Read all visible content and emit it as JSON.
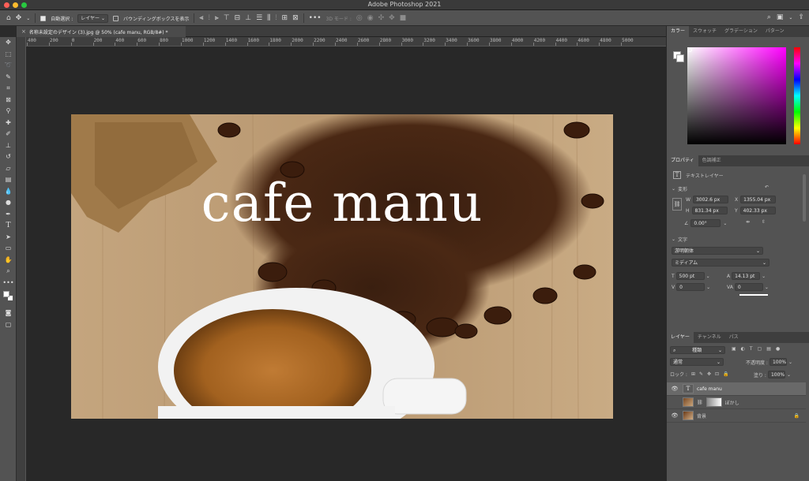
{
  "window": {
    "title": "Adobe Photoshop 2021"
  },
  "options_bar": {
    "auto_select_label": "自動選択 :",
    "auto_select_value": "レイヤー",
    "bounding_box_label": "バウンディングボックスを表示",
    "mode_3d_label": "3D モード :"
  },
  "document": {
    "tab_title": "名称未設定のデザイン (3).jpg @ 50% (cafe manu, RGB/8#) *",
    "canvas_text": "cafe manu",
    "ruler_labels": [
      "400",
      "200",
      "0",
      "200",
      "400",
      "600",
      "800",
      "1000",
      "1200",
      "1400",
      "1600",
      "1800",
      "2000",
      "2200",
      "2400",
      "2600",
      "2800",
      "3000",
      "3200",
      "3400",
      "3600",
      "3800",
      "4000",
      "4200",
      "4400",
      "4600",
      "4800",
      "5000"
    ]
  },
  "color_panel": {
    "tabs": [
      "カラー",
      "スウォッチ",
      "グラデーション",
      "パターン"
    ]
  },
  "properties_panel": {
    "tabs": [
      "プロパティ",
      "色調補正"
    ],
    "layer_kind": "テキストレイヤー",
    "transform_heading": "変形",
    "w_label": "W",
    "w_value": "3002.6 px",
    "h_label": "H",
    "h_value": "831.34 px",
    "x_label": "X",
    "x_value": "1355.04 px",
    "y_label": "Y",
    "y_value": "402.33 px",
    "angle_value": "0.00°",
    "type_heading": "文字",
    "font_family": "游明朝体",
    "font_style": "ミディアム",
    "font_size": "500 pt",
    "leading": "14.13 pt",
    "kerning": "0",
    "tracking": "0"
  },
  "layers_panel": {
    "tabs": [
      "レイヤー",
      "チャンネル",
      "パス"
    ],
    "filter_kind": "種類",
    "blend_mode": "通常",
    "opacity_label": "不透明度 :",
    "opacity_value": "100%",
    "lock_label": "ロック :",
    "fill_label": "塗り :",
    "fill_value": "100%",
    "layers": [
      {
        "name": "cafe manu",
        "type": "text"
      },
      {
        "name": "ぼかし",
        "type": "image-mask"
      },
      {
        "name": "背景",
        "type": "background"
      }
    ]
  },
  "colors": {
    "accent": "#ff00ff",
    "panel_bg": "#535353",
    "canvas_bg": "#282828"
  }
}
